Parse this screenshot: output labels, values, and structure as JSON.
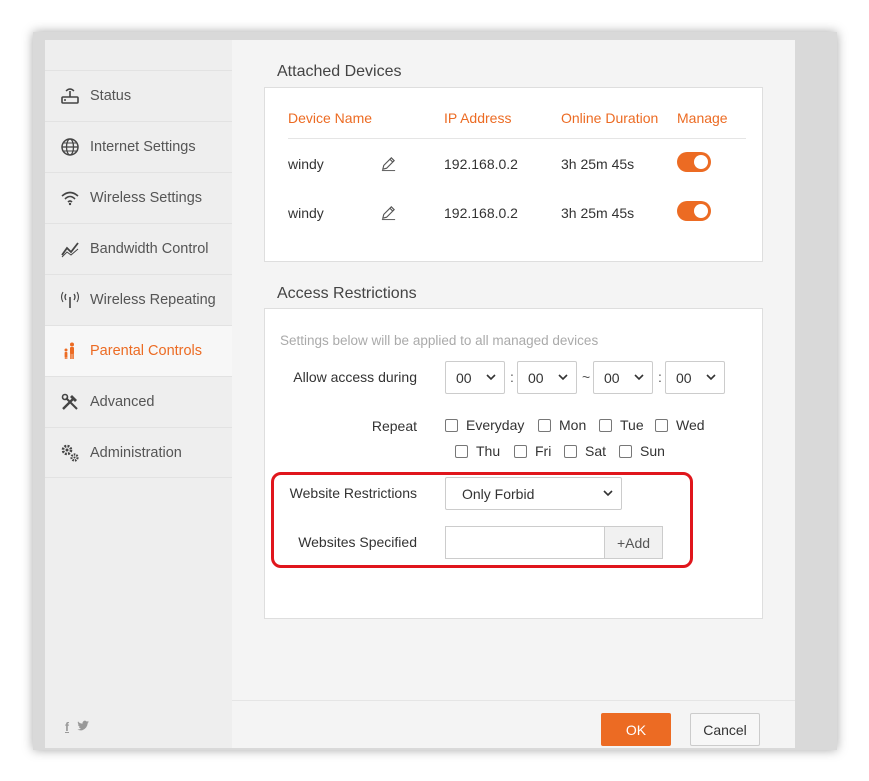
{
  "sidebar": {
    "items": [
      {
        "label": "Status",
        "icon": "router-icon",
        "active": false
      },
      {
        "label": "Internet Settings",
        "icon": "globe-icon",
        "active": false
      },
      {
        "label": "Wireless Settings",
        "icon": "wifi-icon",
        "active": false
      },
      {
        "label": "Bandwidth Control",
        "icon": "chart-line-icon",
        "active": false
      },
      {
        "label": "Wireless Repeating",
        "icon": "antenna-icon",
        "active": false
      },
      {
        "label": "Parental Controls",
        "icon": "family-icon",
        "active": true
      },
      {
        "label": "Advanced",
        "icon": "tools-icon",
        "active": false
      },
      {
        "label": "Administration",
        "icon": "gears-icon",
        "active": false
      }
    ],
    "social": [
      "facebook-icon",
      "twitter-icon"
    ]
  },
  "attached": {
    "title": "Attached Devices",
    "headers": {
      "name": "Device Name",
      "ip": "IP Address",
      "duration": "Online Duration",
      "manage": "Manage"
    },
    "rows": [
      {
        "name": "windy",
        "ip": "192.168.0.2",
        "duration": "3h 25m 45s",
        "managed": true
      },
      {
        "name": "windy",
        "ip": "192.168.0.2",
        "duration": "3h 25m 45s",
        "managed": true
      }
    ]
  },
  "access": {
    "title": "Access Restrictions",
    "hint": "Settings below will be applied to all managed devices",
    "allow_label": "Allow access during",
    "time": {
      "start_h": "00",
      "start_m": "00",
      "sep": "~",
      "end_h": "00",
      "end_m": "00",
      "colon": ":"
    },
    "repeat_label": "Repeat",
    "days": [
      "Everyday",
      "Mon",
      "Tue",
      "Wed",
      "Thu",
      "Fri",
      "Sat",
      "Sun"
    ],
    "website_label": "Website Restrictions",
    "website_mode": "Only Forbid",
    "websites_label": "Websites Specified",
    "websites_value": "",
    "add_label": "+Add"
  },
  "footer": {
    "ok": "OK",
    "cancel": "Cancel"
  },
  "colors": {
    "accent": "#ec6b23",
    "highlight": "#e0161c"
  }
}
